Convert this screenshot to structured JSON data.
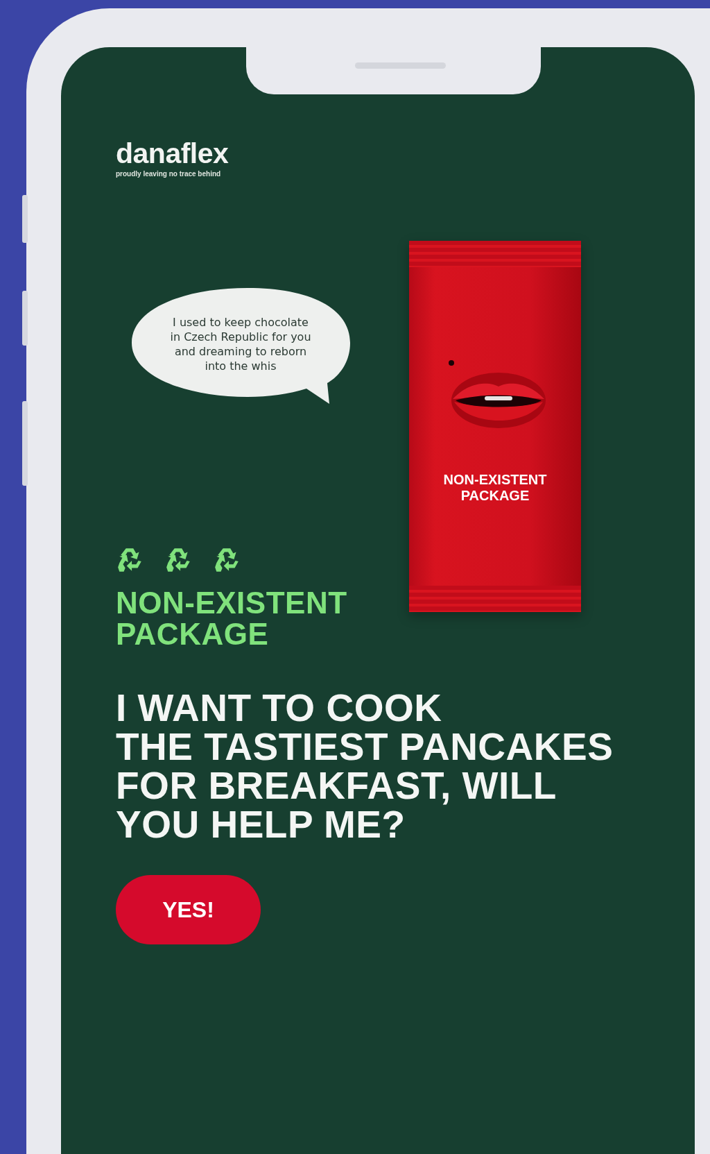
{
  "logo": {
    "wordmark": "danaflex",
    "tagline": "proudly leaving no trace behind"
  },
  "speech_bubble": {
    "text": "I used to keep chocolate\nin Czech Republic for you\nand dreaming to reborn\ninto the whis"
  },
  "package": {
    "label": "NON-EXISTENT\nPACKAGE"
  },
  "badge_text": "NON-EXISTENT\nPACKAGE",
  "headline": "I WANT TO COOK\nTHE TASTIEST PANCAKES\nFOR BREAKFAST, WILL\nYOU HELP ME?",
  "button": {
    "label": "YES!"
  }
}
